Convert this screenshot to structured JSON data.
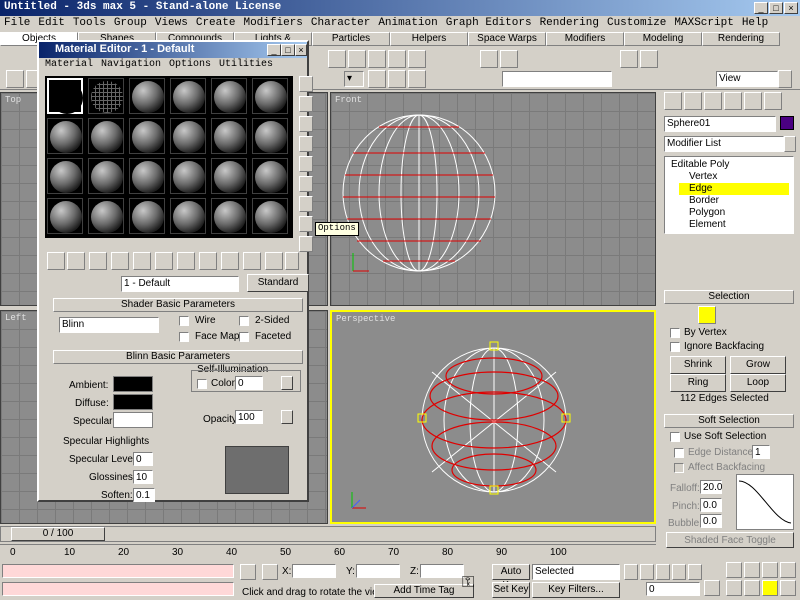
{
  "app": {
    "title": "Untitled - 3ds max 5 - Stand-alone License"
  },
  "menu": [
    "File",
    "Edit",
    "Tools",
    "Group",
    "Views",
    "Create",
    "Modifiers",
    "Character",
    "Animation",
    "Graph Editors",
    "Rendering",
    "Customize",
    "MAXScript",
    "Help"
  ],
  "tabs": [
    "Objects",
    "Shapes",
    "Compounds",
    "Lights & Cameras",
    "Particles",
    "Helpers",
    "Space Warps",
    "Modifiers",
    "Modeling",
    "Rendering"
  ],
  "toolbar": {
    "view_dropdown": "View"
  },
  "viewports": {
    "top": "Top",
    "front": "Front",
    "left": "Left",
    "perspective": "Perspective"
  },
  "material_editor": {
    "title": "Material Editor - 1 - Default",
    "menu": [
      "Material",
      "Navigation",
      "Options",
      "Utilities"
    ],
    "tooltip": "Options",
    "material_name": "1 - Default",
    "material_type": "Standard",
    "shader_rollout": "Shader Basic Parameters",
    "shader": "Blinn",
    "wire": "Wire",
    "two_sided": "2-Sided",
    "face_map": "Face Map",
    "faceted": "Faceted",
    "blinn_rollout": "Blinn Basic Parameters",
    "self_illum": "Self-Illumination",
    "color_label": "Color",
    "color_value": "0",
    "ambient": "Ambient:",
    "diffuse": "Diffuse:",
    "specular": "Specular:",
    "opacity_label": "Opacity:",
    "opacity_value": "100",
    "spec_highlights": "Specular Highlights",
    "spec_level": "Specular Level:",
    "spec_level_value": "0",
    "glossiness": "Glossiness:",
    "glossiness_value": "10",
    "soften": "Soften:",
    "soften_value": "0.1"
  },
  "command_panel": {
    "object_name": "Sphere01",
    "object_color": "#4b0082",
    "modifier_list": "Modifier List",
    "stack": [
      "Editable Poly",
      "Vertex",
      "Edge",
      "Border",
      "Polygon",
      "Element"
    ],
    "selected_stack_item": "Edge",
    "selection_rollout": "Selection",
    "by_vertex": "By Vertex",
    "ignore_backfacing": "Ignore Backfacing",
    "shrink": "Shrink",
    "grow": "Grow",
    "ring": "Ring",
    "loop": "Loop",
    "selected_count": "112 Edges Selected",
    "soft_selection_rollout": "Soft Selection",
    "use_soft_selection": "Use Soft Selection",
    "edge_distance": "Edge Distance:",
    "edge_distance_value": "1",
    "affect_backfacing": "Affect Backfacing",
    "falloff_label": "Falloff:",
    "falloff_value": "20.0",
    "pinch_label": "Pinch:",
    "pinch_value": "0.0",
    "bubble_label": "Bubble:",
    "bubble_value": "0.0",
    "shaded_face_toggle": "Shaded Face Toggle"
  },
  "timeline": {
    "frame": "0 / 100",
    "ticks": [
      "0",
      "10",
      "20",
      "30",
      "40",
      "50",
      "60",
      "70",
      "80",
      "90",
      "100"
    ]
  },
  "status": {
    "prompt": "Click and drag to rotate the view.",
    "add_time_tag": "Add Time Tag",
    "x_label": "X:",
    "y_label": "Y:",
    "z_label": "Z:",
    "auto_key": "Auto Key",
    "set_key": "Set Key",
    "selected": "Selected",
    "key_filters": "Key Filters...",
    "frame_value": "0"
  },
  "colors": {
    "selection_yellow": "#ffff00",
    "edge_red": "#e00000",
    "title_blue": "#0a246a"
  }
}
